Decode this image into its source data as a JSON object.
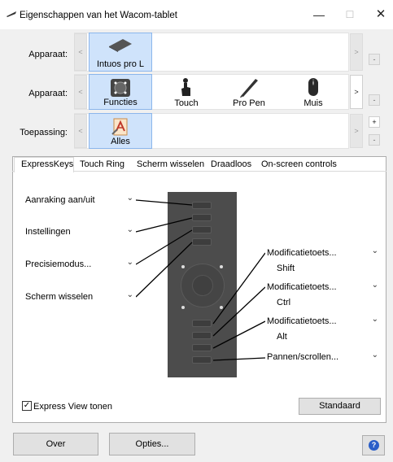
{
  "window": {
    "title": "Eigenschappen van het Wacom-tablet",
    "minimize": "—",
    "maximize": "☐",
    "close": "✕"
  },
  "device_row": {
    "label": "Apparaat:",
    "left_arrow": "<",
    "right_arrow": ">",
    "minus": "-",
    "tiles": [
      {
        "label": "Intuos pro L",
        "icon": "tablet-icon",
        "selected": true
      }
    ]
  },
  "tool_row": {
    "label": "Apparaat:",
    "left_arrow": "<",
    "right_arrow": ">",
    "minus": "-",
    "tiles": [
      {
        "label": "Functies",
        "icon": "functions-icon",
        "selected": true
      },
      {
        "label": "Touch",
        "icon": "touch-icon",
        "selected": false
      },
      {
        "label": "Pro Pen",
        "icon": "pen-icon",
        "selected": false
      },
      {
        "label": "Muis",
        "icon": "mouse-icon",
        "selected": false
      }
    ]
  },
  "app_row": {
    "label": "Toepassing:",
    "left_arrow": "<",
    "right_arrow": ">",
    "plus": "+",
    "minus": "-",
    "tiles": [
      {
        "label": "Alles",
        "icon": "all-apps-icon",
        "selected": true
      }
    ]
  },
  "tabs": [
    {
      "label": "ExpressKeys",
      "active": true
    },
    {
      "label": "Touch Ring",
      "active": false
    },
    {
      "label": "Scherm wisselen",
      "active": false
    },
    {
      "label": "Draadloos",
      "active": false
    },
    {
      "label": "On-screen controls",
      "active": false
    }
  ],
  "left_dropdowns": [
    {
      "value": "Aanraking aan/uit"
    },
    {
      "value": "Instellingen"
    },
    {
      "value": "Precisiemodus..."
    },
    {
      "value": "Scherm wisselen"
    }
  ],
  "right_dropdowns": [
    {
      "value": "Modificatietoets...",
      "sub": "Shift"
    },
    {
      "value": "Modificatietoets...",
      "sub": "Ctrl"
    },
    {
      "value": "Modificatietoets...",
      "sub": "Alt"
    },
    {
      "value": "Pannen/scrollen...",
      "sub": ""
    }
  ],
  "chevron": "⌄",
  "express_view": {
    "label": "Express View tonen",
    "checked": true,
    "check_mark": "✓"
  },
  "buttons": {
    "standard": "Standaard",
    "about": "Over",
    "options": "Opties...",
    "help": "?"
  },
  "colors": {
    "selected_tile_bg": "#cfe3fb",
    "selected_tile_border": "#8bb6ec",
    "tablet_body": "#4c4c4c",
    "help_icon": "#2a5ec8"
  }
}
